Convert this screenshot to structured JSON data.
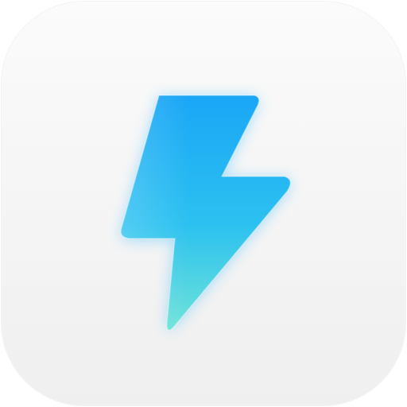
{
  "app_icon": {
    "icon": "lightning-bolt-icon",
    "colors": {
      "tile_top": "#fbfbfb",
      "tile_bottom": "#efefef",
      "bolt_top": "#1aa6f6",
      "bolt_mid": "#2cc1f0",
      "bolt_bottom": "#6fe3d8",
      "glow": "#39b8ff"
    }
  }
}
